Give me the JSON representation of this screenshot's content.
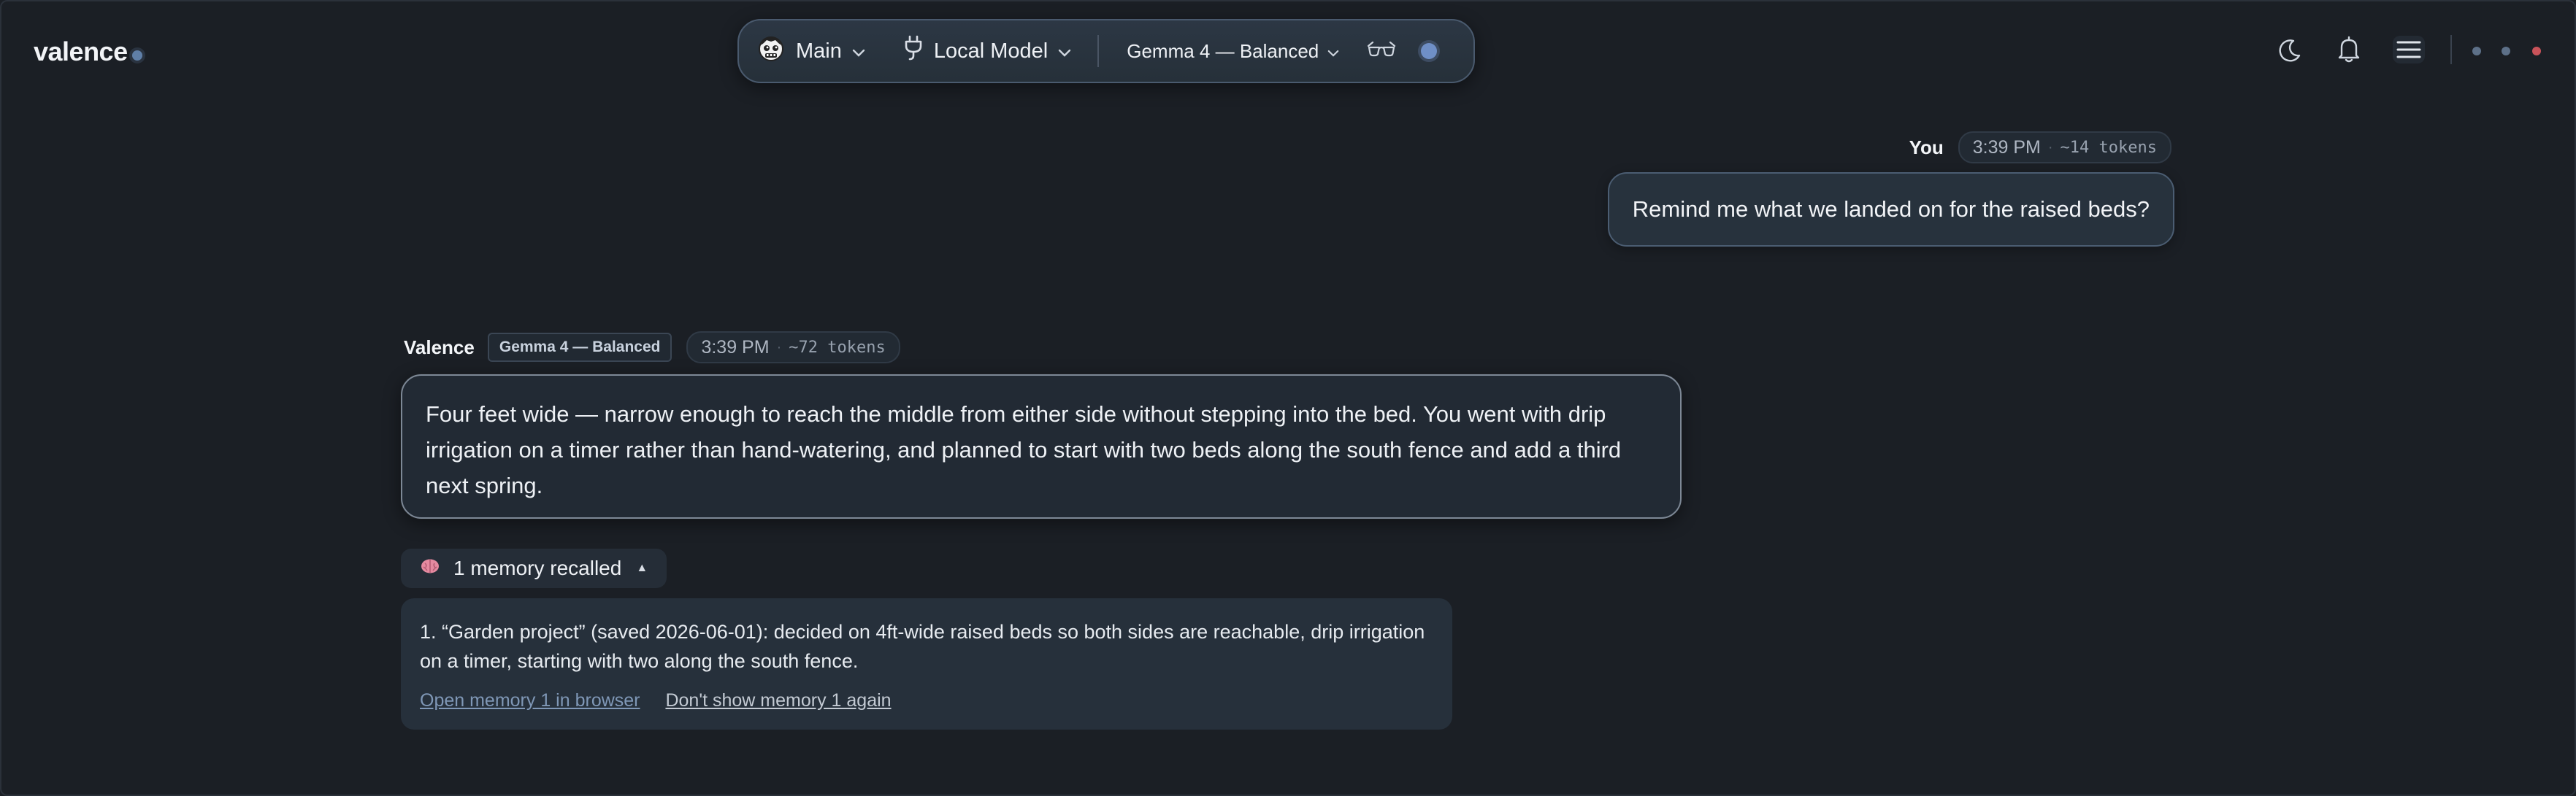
{
  "brand": {
    "name": "valence"
  },
  "toolbar": {
    "workspace_label": "Main",
    "model_source_label": "Local Model",
    "model_label": "Gemma 4 — Balanced"
  },
  "conversation": {
    "user_message": {
      "author": "You",
      "time": "3:39 PM",
      "separator": "·",
      "tokens": "~14 tokens",
      "text": "Remind me what we landed on for the raised beds?"
    },
    "assistant_message": {
      "author": "Valence",
      "model_tag": "Gemma 4 — Balanced",
      "time": "3:39 PM",
      "separator": "·",
      "tokens": "~72 tokens",
      "text": "Four feet wide — narrow enough to reach the middle from either side without stepping into the bed. You went with drip irrigation on a timer rather than hand-watering, and planned to start with two beds along the south fence and add a third next spring."
    }
  },
  "memory": {
    "toggle_label": "1 memory recalled",
    "items": [
      {
        "text": "1. “Garden project” (saved 2026-06-01): decided on 4ft-wide raised beds so both sides are reachable, drip irrigation on a timer, starting with two along the south fence.",
        "open_link": "Open memory 1 in browser",
        "hide_link": "Don't show memory 1 again"
      }
    ]
  },
  "icons": {
    "workspace": "mascot-face-icon",
    "model_source": "plug-icon",
    "glasses": "glasses-icon",
    "theme": "moon-icon",
    "notifications": "bell-icon",
    "menu": "hamburger-menu-icon"
  },
  "colors": {
    "background": "#1b1f25",
    "accent": "#6f8fc6",
    "window_dot_red": "#c9535a",
    "window_dot_gray": "#5d7088",
    "link": "#7f97b6"
  }
}
